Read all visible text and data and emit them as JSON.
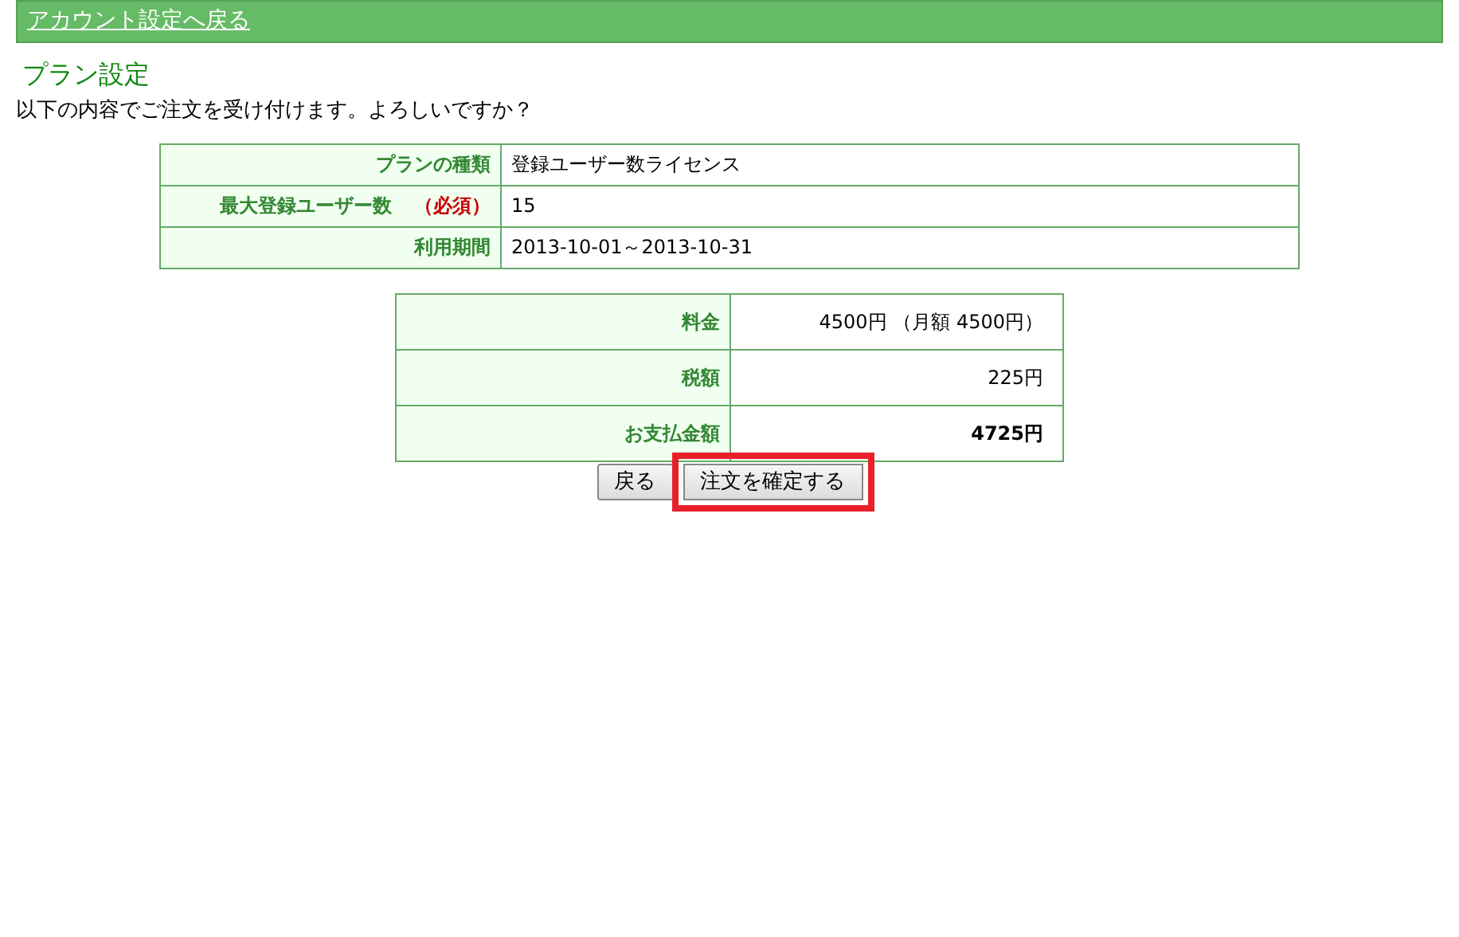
{
  "header": {
    "back_link": "アカウント設定へ戻る"
  },
  "title": "プラン設定",
  "message": "以下の内容でご注文を受け付けます。よろしいですか？",
  "plan_table": [
    {
      "label": "プランの種類",
      "value": "登録ユーザー数ライセンス"
    },
    {
      "label": "最大登録ユーザー数",
      "required_mark": "（必須）",
      "value": "15"
    },
    {
      "label": "利用期間",
      "value": "2013-10-01～2013-10-31"
    }
  ],
  "price_table": [
    {
      "label": "料金",
      "value": "4500円 （月額 4500円）",
      "bold": false
    },
    {
      "label": "税額",
      "value": "225円",
      "bold": false
    },
    {
      "label": "お支払金額",
      "value": "4725円",
      "bold": true
    }
  ],
  "buttons": [
    {
      "label": "戻る",
      "highlighted": false
    },
    {
      "label": "注文を確定する",
      "highlighted": true
    }
  ]
}
